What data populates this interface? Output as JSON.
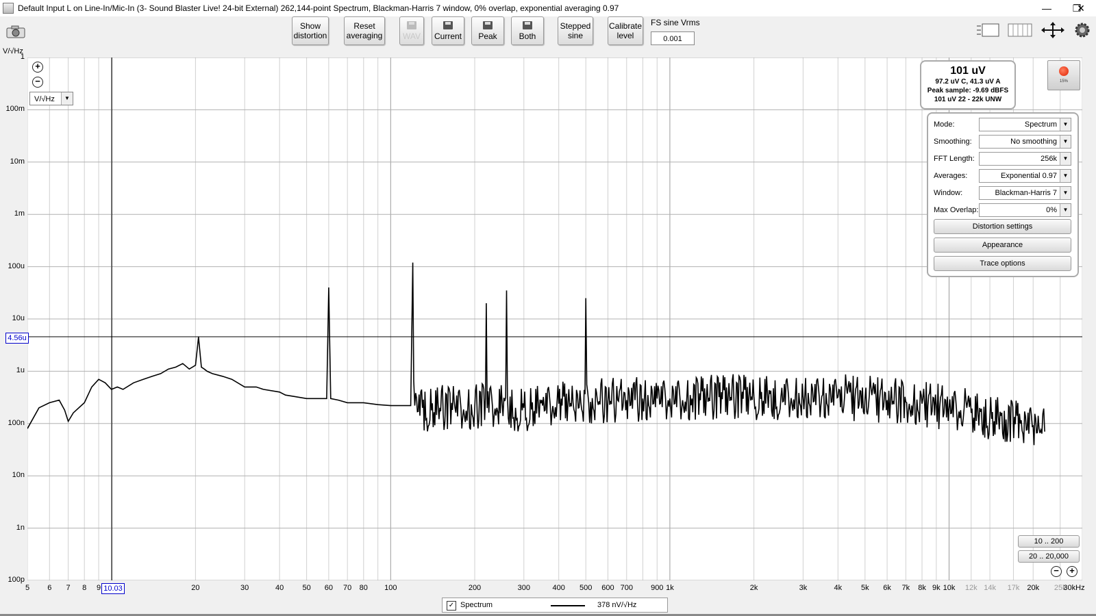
{
  "window": {
    "title": "Default Input L on Line-In/Mic-In (3- Sound Blaster Live! 24-bit External) 262,144-point Spectrum, Blackman-Harris 7 window, 0% overlap, exponential averaging 0.97",
    "minimize": "—",
    "maximize": "❐",
    "close": "✕"
  },
  "toolbar": {
    "show_distortion": [
      "Show",
      "distortion"
    ],
    "reset_averaging": [
      "Reset",
      "averaging"
    ],
    "wav": "WAV",
    "current": "Current",
    "peak": "Peak",
    "both": "Both",
    "stepped_sine": [
      "Stepped",
      "sine"
    ],
    "calibrate_level": [
      "Calibrate",
      "level"
    ],
    "fs_sine_label": "FS sine Vrms",
    "fs_sine_value": "0.001",
    "icons": [
      "camera-icon",
      "layout-icon",
      "columns-icon",
      "move-icon",
      "gear-icon"
    ]
  },
  "plot": {
    "y_unit": "V/√Hz",
    "unit_select": "V/√Hz",
    "y_cursor_value": "4.56u",
    "x_cursor_value": "10.03"
  },
  "level_meter": {
    "main": "101 uV",
    "line1": "97.2 uV C, 41.3 uV A",
    "line2": "Peak sample: -9.69 dBFS",
    "line3": "101 uV 22 - 22k UNW",
    "record_pct": "15%"
  },
  "settings": {
    "rows": [
      {
        "label": "Mode:",
        "value": "Spectrum"
      },
      {
        "label": "Smoothing:",
        "value": "No  smoothing"
      },
      {
        "label": "FFT Length:",
        "value": "256k"
      },
      {
        "label": "Averages:",
        "value": "Exponential 0.97"
      },
      {
        "label": "Window:",
        "value": "Blackman-Harris 7"
      },
      {
        "label": "Max Overlap:",
        "value": "0%"
      }
    ],
    "buttons": [
      "Distortion settings",
      "Appearance",
      "Trace options"
    ]
  },
  "range_buttons": [
    "10 .. 200",
    "20 .. 20,000"
  ],
  "legend": {
    "checked": "✓",
    "name": "Spectrum",
    "value": "378 nV/√Hz"
  },
  "chart_data": {
    "type": "line",
    "x_scale": "log",
    "y_scale": "log",
    "xlim": [
      5,
      30000
    ],
    "ylim": [
      1e-10,
      1
    ],
    "x_tick_labels": [
      "5",
      "6",
      "7",
      "8",
      "9",
      "10.03",
      "20",
      "30",
      "40",
      "50",
      "60",
      "70",
      "80",
      "100",
      "200",
      "300",
      "400",
      "500",
      "600",
      "700",
      "900",
      "1k",
      "2k",
      "3k",
      "4k",
      "5k",
      "6k",
      "7k",
      "8k",
      "9k",
      "10k",
      "12k",
      "14k",
      "17k",
      "20k",
      "25k",
      "30kHz"
    ],
    "y_tick_labels": [
      "1",
      "100m",
      "10m",
      "1m",
      "100u",
      "10u",
      "1u",
      "100n",
      "10n",
      "1n",
      "100p"
    ],
    "ylabel": "V/√Hz",
    "grid": true,
    "series": [
      {
        "name": "Spectrum",
        "x": [
          5,
          5.5,
          6,
          6.5,
          6.8,
          7,
          7.3,
          8,
          8.5,
          9,
          9.5,
          10,
          10.5,
          11,
          12,
          13,
          14,
          15,
          16,
          17,
          18,
          19,
          20,
          20.5,
          21,
          21.5,
          22,
          23,
          25,
          27,
          30,
          33,
          35,
          40,
          42,
          45,
          50,
          55,
          59,
          60,
          61,
          65,
          70,
          75,
          80,
          90,
          100,
          110,
          118,
          120,
          122,
          130,
          150,
          170,
          200,
          220,
          240,
          260,
          280,
          300,
          350,
          400,
          450,
          480,
          500,
          520,
          550,
          600,
          650,
          700,
          750,
          800,
          900,
          1000,
          1200,
          1500,
          2000,
          2500,
          3000,
          3500,
          4000,
          5000,
          6000,
          7000,
          8000,
          9000,
          10000,
          11000,
          12000,
          14000,
          16000,
          18000,
          20000,
          21000,
          22000
        ],
        "y": [
          8e-08,
          2e-07,
          2.5e-07,
          2.8e-07,
          1.8e-07,
          1.1e-07,
          1.6e-07,
          2.5e-07,
          5e-07,
          7e-07,
          6e-07,
          4.5e-07,
          5e-07,
          4.5e-07,
          6e-07,
          7e-07,
          8e-07,
          9e-07,
          1.1e-06,
          1.2e-06,
          1.4e-06,
          1.1e-06,
          1.3e-06,
          4.5e-06,
          1.2e-06,
          1.1e-06,
          1e-06,
          9e-07,
          8e-07,
          7e-07,
          5e-07,
          5e-07,
          4.5e-07,
          4e-07,
          3.5e-07,
          3.3e-07,
          3e-07,
          3e-07,
          3e-07,
          4e-05,
          3e-07,
          2.8e-07,
          2.5e-07,
          2.5e-07,
          2.5e-07,
          2.3e-07,
          2.2e-07,
          2.2e-07,
          2.2e-07,
          0.00012,
          2.2e-07,
          2e-07,
          2e-07,
          2e-07,
          2e-07,
          2e-05,
          2e-07,
          3.5e-05,
          2e-07,
          2e-07,
          2.2e-07,
          2.4e-07,
          2.5e-07,
          2.5e-07,
          2.5e-05,
          2.6e-07,
          2.7e-07,
          2.7e-07,
          2.8e-07,
          2.8e-07,
          2.8e-07,
          3e-07,
          3e-07,
          3e-07,
          3e-07,
          3.2e-07,
          3.3e-07,
          3.3e-07,
          3.3e-07,
          3.3e-07,
          3.2e-07,
          3e-07,
          2.8e-07,
          2.6e-07,
          2.4e-07,
          2.2e-07,
          2e-07,
          1.8e-07,
          1.6e-07,
          1.4e-07,
          1.2e-07,
          1e-07,
          9e-08,
          8e-08,
          7e-08
        ]
      }
    ]
  }
}
